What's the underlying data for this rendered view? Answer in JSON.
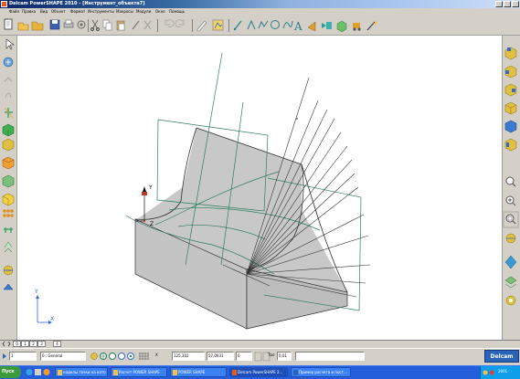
{
  "window": {
    "title": "Delcam PowerSHAPE 2010 - [Инструмент_объекта7]"
  },
  "menu": [
    "Файл",
    "Правка",
    "Вид",
    "Объект",
    "Формат",
    "Инструменты",
    "Макросы",
    "Модули",
    "Окно",
    "Помощь"
  ],
  "top_toolbar_icons": [
    "pointer-icon",
    "open-icon",
    "folder-icon",
    "save-icon",
    "print-icon",
    "settings-icon",
    "cut-icon",
    "copy-icon",
    "paste-icon",
    "eyedropper-icon",
    "delete-icon",
    "undo-icon",
    "redo-icon",
    "edit-icon",
    "line-icon",
    "arc-icon",
    "circle-icon",
    "curve-icon",
    "text-icon",
    "horn-icon",
    "dimension-icon",
    "box-icon",
    "tools-icon",
    "magic-wand-icon"
  ],
  "left_toolbar_icons": [
    "select-icon",
    "workplane-icon",
    "edit-workplane-icon",
    "curve-tool-icon",
    "axis-icon",
    "solid-icon",
    "surface-icon",
    "feature-icon",
    "primitive-icon",
    "box-solid-icon",
    "pattern-icon",
    "assembly-icon",
    "cone-icon",
    "sphere-icon",
    "wedge-icon"
  ],
  "right_toolbar_icons": [
    "view-top-icon",
    "view-front-icon",
    "view-right-icon",
    "view-iso-icon",
    "view-iso2-icon",
    "view-left-icon",
    "zoom-icon",
    "zoom-in-icon",
    "zoom-fit-icon",
    "shaded-icon",
    "wireframe-icon",
    "hidden-line-icon",
    "sphere-view-icon"
  ],
  "viewport": {
    "axis_labels": {
      "y": "Y",
      "x": "X",
      "z": "Z"
    }
  },
  "tabs": [
    "0",
    "1",
    "2",
    "3",
    "4"
  ],
  "status": {
    "level": "1",
    "level_name": "0 : General",
    "coord_x": "125,302",
    "coord_y": "57,0931",
    "coord_z": "0",
    "tolerance_label": "Tол",
    "tolerance": "0,01",
    "logo": "Delcam"
  },
  "taskbar": {
    "start": "Пуск",
    "tasks": [
      "наделы точки на кото",
      "Расчет POWER SHAPE",
      "POWER SHAPE",
      "Delcam PowerSHAPE 2...",
      "Пример расчета и пост..."
    ],
    "clock": "2001"
  },
  "colors": {
    "wire": "#2e7d5b",
    "solid_face": "#c8c8c8",
    "solid_edge": "#303030",
    "title_start": "#0a246a"
  }
}
